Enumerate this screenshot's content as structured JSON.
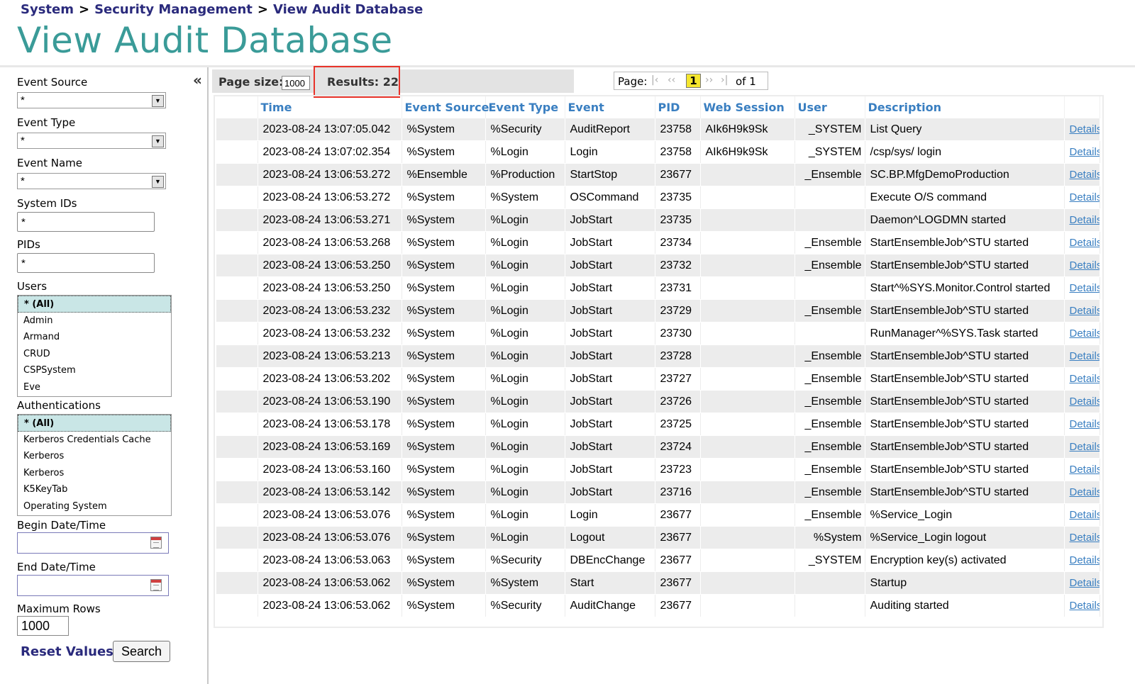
{
  "breadcrumb": {
    "items": [
      "System",
      "Security Management",
      "View Audit Database"
    ],
    "separator": ">"
  },
  "title": "View Audit Database",
  "sidebar": {
    "collapse_glyph": "«",
    "event_source": {
      "label": "Event Source",
      "value": "*"
    },
    "event_type": {
      "label": "Event Type",
      "value": "*"
    },
    "event_name": {
      "label": "Event Name",
      "value": "*"
    },
    "system_ids": {
      "label": "System IDs",
      "value": "*"
    },
    "pids": {
      "label": "PIDs",
      "value": "*"
    },
    "users": {
      "label": "Users",
      "options": [
        "* (All)",
        "Admin",
        "Armand",
        "CRUD",
        "CSPSystem",
        "Eve"
      ]
    },
    "authentications": {
      "label": "Authentications",
      "options": [
        "* (All)",
        "Kerberos Credentials Cache",
        "Kerberos",
        "Kerberos",
        "K5KeyTab",
        "Operating System"
      ]
    },
    "begin_date": {
      "label": "Begin Date/Time",
      "value": ""
    },
    "end_date": {
      "label": "End Date/Time",
      "value": ""
    },
    "max_rows": {
      "label": "Maximum Rows",
      "value": "1000"
    },
    "reset_label": "Reset Values",
    "search_label": "Search"
  },
  "pager": {
    "page_size_label": "Page size:",
    "page_size_value": "1000",
    "results_label": "Results: 22",
    "page_label": "Page:",
    "first": "|‹",
    "prev": "‹‹",
    "current": "1",
    "next": "››",
    "last": "›|",
    "of_label": "of 1"
  },
  "table": {
    "columns": [
      "Time",
      "Event Source",
      "Event Type",
      "Event",
      "PID",
      "Web Session",
      "User",
      "Description"
    ],
    "details_label": "Details",
    "rows": [
      [
        "2023-08-24 13:07:05.042",
        "%System",
        "%Security",
        "AuditReport",
        "23758",
        "AIk6H9k9Sk",
        "_SYSTEM",
        "List Query"
      ],
      [
        "2023-08-24 13:07:02.354",
        "%System",
        "%Login",
        "Login",
        "23758",
        "AIk6H9k9Sk",
        "_SYSTEM",
        "/csp/sys/ login"
      ],
      [
        "2023-08-24 13:06:53.272",
        "%Ensemble",
        "%Production",
        "StartStop",
        "23677",
        "",
        "_Ensemble",
        "SC.BP.MfgDemoProduction"
      ],
      [
        "2023-08-24 13:06:53.272",
        "%System",
        "%System",
        "OSCommand",
        "23735",
        "",
        "",
        "Execute O/S command"
      ],
      [
        "2023-08-24 13:06:53.271",
        "%System",
        "%Login",
        "JobStart",
        "23735",
        "",
        "",
        "Daemon^LOGDMN started"
      ],
      [
        "2023-08-24 13:06:53.268",
        "%System",
        "%Login",
        "JobStart",
        "23734",
        "",
        "_Ensemble",
        "StartEnsembleJob^STU started"
      ],
      [
        "2023-08-24 13:06:53.250",
        "%System",
        "%Login",
        "JobStart",
        "23732",
        "",
        "_Ensemble",
        "StartEnsembleJob^STU started"
      ],
      [
        "2023-08-24 13:06:53.250",
        "%System",
        "%Login",
        "JobStart",
        "23731",
        "",
        "",
        "Start^%SYS.Monitor.Control started"
      ],
      [
        "2023-08-24 13:06:53.232",
        "%System",
        "%Login",
        "JobStart",
        "23729",
        "",
        "_Ensemble",
        "StartEnsembleJob^STU started"
      ],
      [
        "2023-08-24 13:06:53.232",
        "%System",
        "%Login",
        "JobStart",
        "23730",
        "",
        "",
        "RunManager^%SYS.Task started"
      ],
      [
        "2023-08-24 13:06:53.213",
        "%System",
        "%Login",
        "JobStart",
        "23728",
        "",
        "_Ensemble",
        "StartEnsembleJob^STU started"
      ],
      [
        "2023-08-24 13:06:53.202",
        "%System",
        "%Login",
        "JobStart",
        "23727",
        "",
        "_Ensemble",
        "StartEnsembleJob^STU started"
      ],
      [
        "2023-08-24 13:06:53.190",
        "%System",
        "%Login",
        "JobStart",
        "23726",
        "",
        "_Ensemble",
        "StartEnsembleJob^STU started"
      ],
      [
        "2023-08-24 13:06:53.178",
        "%System",
        "%Login",
        "JobStart",
        "23725",
        "",
        "_Ensemble",
        "StartEnsembleJob^STU started"
      ],
      [
        "2023-08-24 13:06:53.169",
        "%System",
        "%Login",
        "JobStart",
        "23724",
        "",
        "_Ensemble",
        "StartEnsembleJob^STU started"
      ],
      [
        "2023-08-24 13:06:53.160",
        "%System",
        "%Login",
        "JobStart",
        "23723",
        "",
        "_Ensemble",
        "StartEnsembleJob^STU started"
      ],
      [
        "2023-08-24 13:06:53.142",
        "%System",
        "%Login",
        "JobStart",
        "23716",
        "",
        "_Ensemble",
        "StartEnsembleJob^STU started"
      ],
      [
        "2023-08-24 13:06:53.076",
        "%System",
        "%Login",
        "Login",
        "23677",
        "",
        "_Ensemble",
        "%Service_Login"
      ],
      [
        "2023-08-24 13:06:53.076",
        "%System",
        "%Login",
        "Logout",
        "23677",
        "",
        "%System",
        "%Service_Login logout"
      ],
      [
        "2023-08-24 13:06:53.063",
        "%System",
        "%Security",
        "DBEncChange",
        "23677",
        "",
        "_SYSTEM",
        "Encryption key(s) activated"
      ],
      [
        "2023-08-24 13:06:53.062",
        "%System",
        "%System",
        "Start",
        "23677",
        "",
        "",
        "Startup"
      ],
      [
        "2023-08-24 13:06:53.062",
        "%System",
        "%Security",
        "AuditChange",
        "23677",
        "",
        "",
        "Auditing started"
      ]
    ]
  },
  "colors": {
    "title": "#3a9b98",
    "breadcrumb": "#2a2a7c",
    "header_text": "#3a7fc1",
    "highlight_box": "#e8332a",
    "current_page": "#f5e62e"
  }
}
